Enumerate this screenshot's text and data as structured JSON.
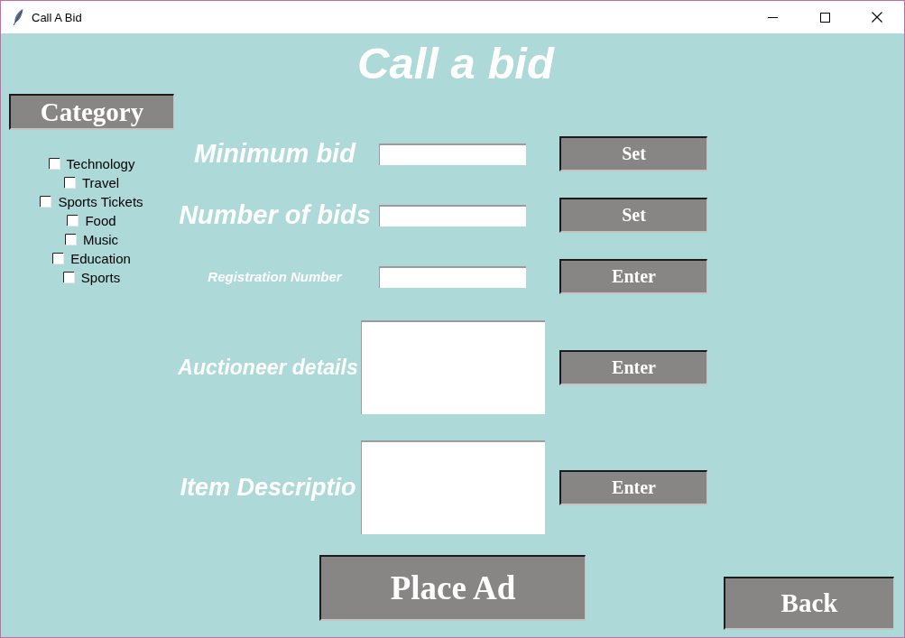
{
  "window": {
    "title": "Call A Bid"
  },
  "heading": "Call a bid",
  "category": {
    "button": "Category",
    "options": [
      {
        "label": "Technology",
        "checked": false
      },
      {
        "label": "Travel",
        "checked": false
      },
      {
        "label": "Sports Tickets",
        "checked": false
      },
      {
        "label": "Food",
        "checked": false
      },
      {
        "label": "Music",
        "checked": false
      },
      {
        "label": "Education",
        "checked": false
      },
      {
        "label": "Sports",
        "checked": false
      }
    ]
  },
  "form": {
    "rows": [
      {
        "label": "Minimum bid",
        "kind": "entry",
        "button": "Set"
      },
      {
        "label": "Number of bids",
        "kind": "entry",
        "button": "Set"
      },
      {
        "label": "Registration Number",
        "kind": "entry",
        "button": "Enter"
      },
      {
        "label": "Auctioneer details",
        "kind": "text_area",
        "button": "Enter"
      },
      {
        "label": "Item Descriptio",
        "kind": "text_area",
        "button": "Enter"
      }
    ]
  },
  "actions": {
    "place_ad": "Place Ad",
    "back": "Back"
  }
}
